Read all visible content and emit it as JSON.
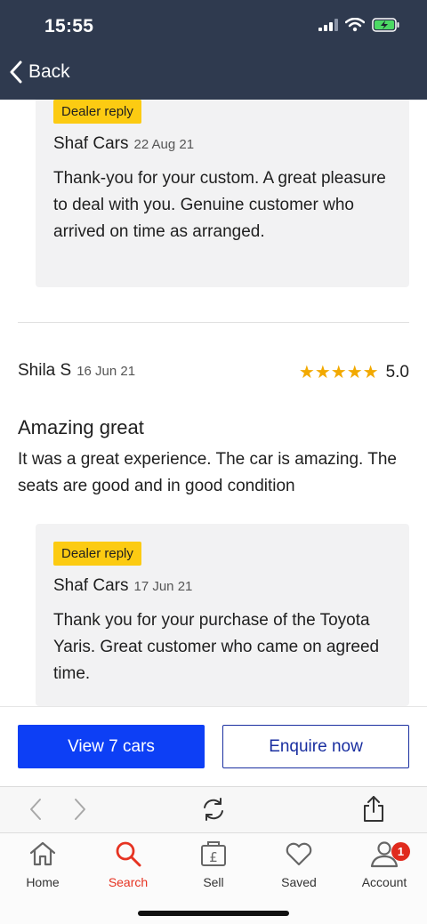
{
  "status_bar": {
    "time": "15:55"
  },
  "nav": {
    "back_label": "Back"
  },
  "reply_top": {
    "badge": "Dealer reply",
    "dealer": "Shaf Cars",
    "date": "22 Aug 21",
    "text": "Thank-you for your custom. A great pleasure to deal with you. Genuine customer who arrived on time as arranged."
  },
  "review": {
    "author": "Shila S",
    "date": "16 Jun 21",
    "stars": "★★★★★",
    "rating": "5.0",
    "title": "Amazing great",
    "text": "It was a great experience. The car is amazing. The seats are good and in good condition",
    "reply": {
      "badge": "Dealer reply",
      "dealer": "Shaf Cars",
      "date": "17 Jun 21",
      "text": "Thank you for your purchase of the Toyota Yaris. Great customer who came on agreed time."
    }
  },
  "actions": {
    "view_cars": "View 7 cars",
    "enquire": "Enquire now"
  },
  "tabs": [
    {
      "label": "Home",
      "icon": "home-icon"
    },
    {
      "label": "Search",
      "icon": "search-icon"
    },
    {
      "label": "Sell",
      "icon": "sell-pound-icon"
    },
    {
      "label": "Saved",
      "icon": "heart-icon"
    },
    {
      "label": "Account",
      "icon": "account-icon",
      "badge": "1"
    }
  ],
  "colors": {
    "topbar": "#2f3a4f",
    "primary": "#0d3ff5",
    "badge": "#fccb12",
    "star": "#f2a900",
    "active_tab": "#e63322"
  }
}
